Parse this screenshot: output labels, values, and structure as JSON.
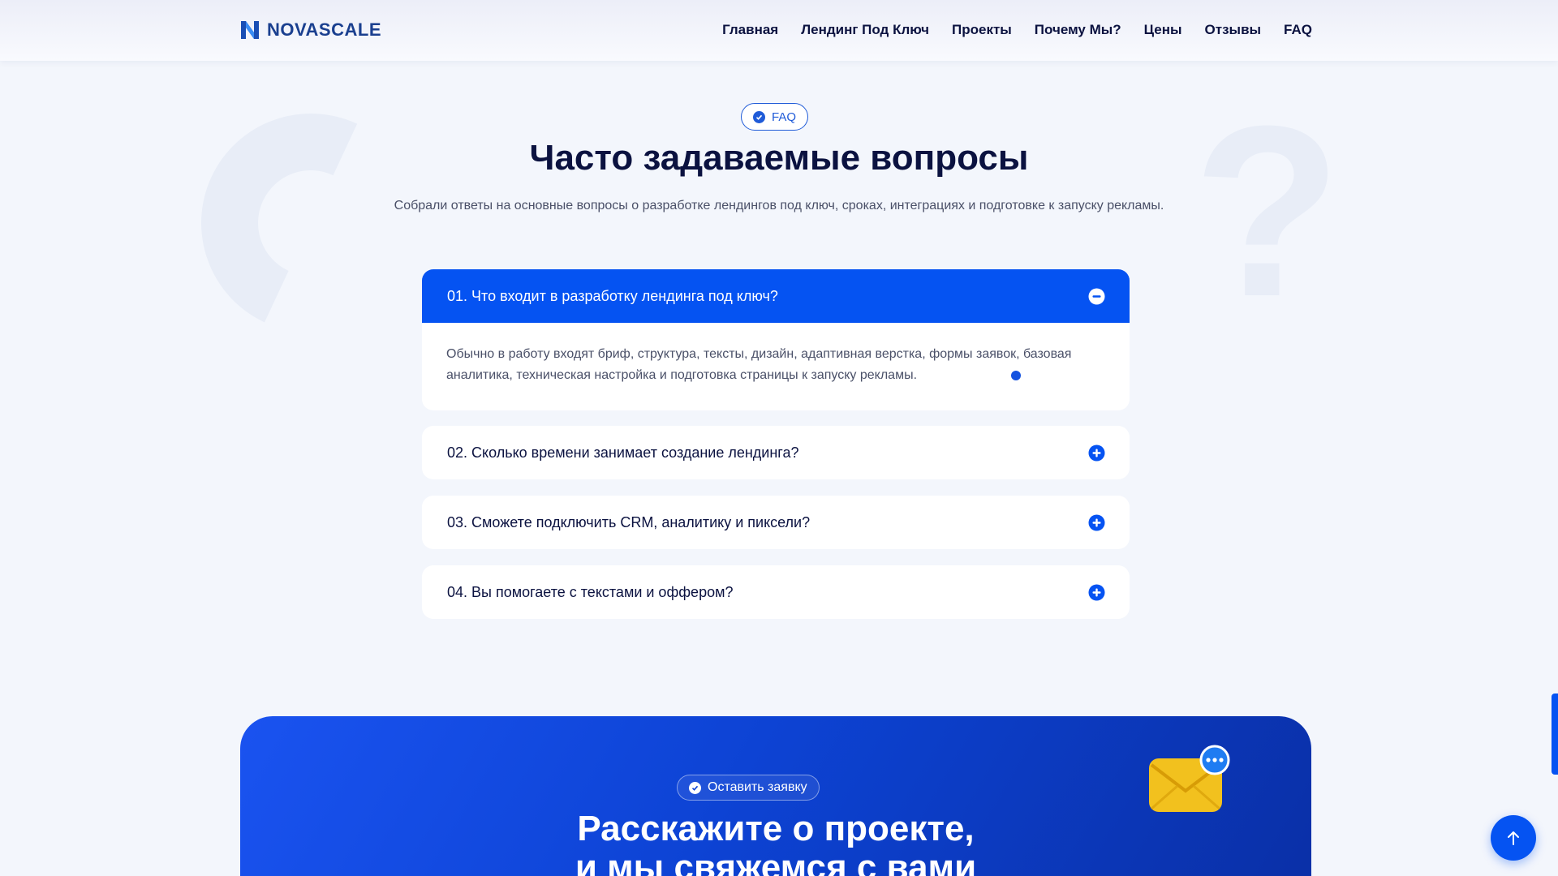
{
  "header": {
    "logo_text": "NOVASCALE",
    "nav": [
      "Главная",
      "Лендинг Под Ключ",
      "Проекты",
      "Почему Мы?",
      "Цены",
      "Отзывы",
      "FAQ"
    ]
  },
  "faq": {
    "badge": "FAQ",
    "title": "Часто задаваемые вопросы",
    "subtitle": "Собрали ответы на основные вопросы о разработке лендингов под ключ, сроках, интеграциях и подготовке к запуску рекламы.",
    "items": [
      {
        "question": "01. Что входит в разработку лендинга под ключ?",
        "answer": "Обычно в работу входят бриф, структура, тексты, дизайн, адаптивная верстка, формы заявок, базовая аналитика, техническая настройка и подготовка страницы к запуску рекламы.",
        "open": true
      },
      {
        "question": "02. Сколько времени занимает создание лендинга?",
        "open": false
      },
      {
        "question": "03. Сможете подключить CRM, аналитику и пиксели?",
        "open": false
      },
      {
        "question": "04. Вы помогаете с текстами и оффером?",
        "open": false
      }
    ]
  },
  "cta": {
    "badge": "Оставить заявку",
    "title_line1": "Расскажите о проекте,",
    "title_line2": "и мы свяжемся с вами"
  },
  "colors": {
    "accent": "#0553f2",
    "heading": "#0b1240",
    "background": "#f3f6fc"
  },
  "icons": {
    "scroll_top": "arrow-up-icon",
    "collapse": "minus-circle-icon",
    "expand": "plus-circle-icon"
  }
}
